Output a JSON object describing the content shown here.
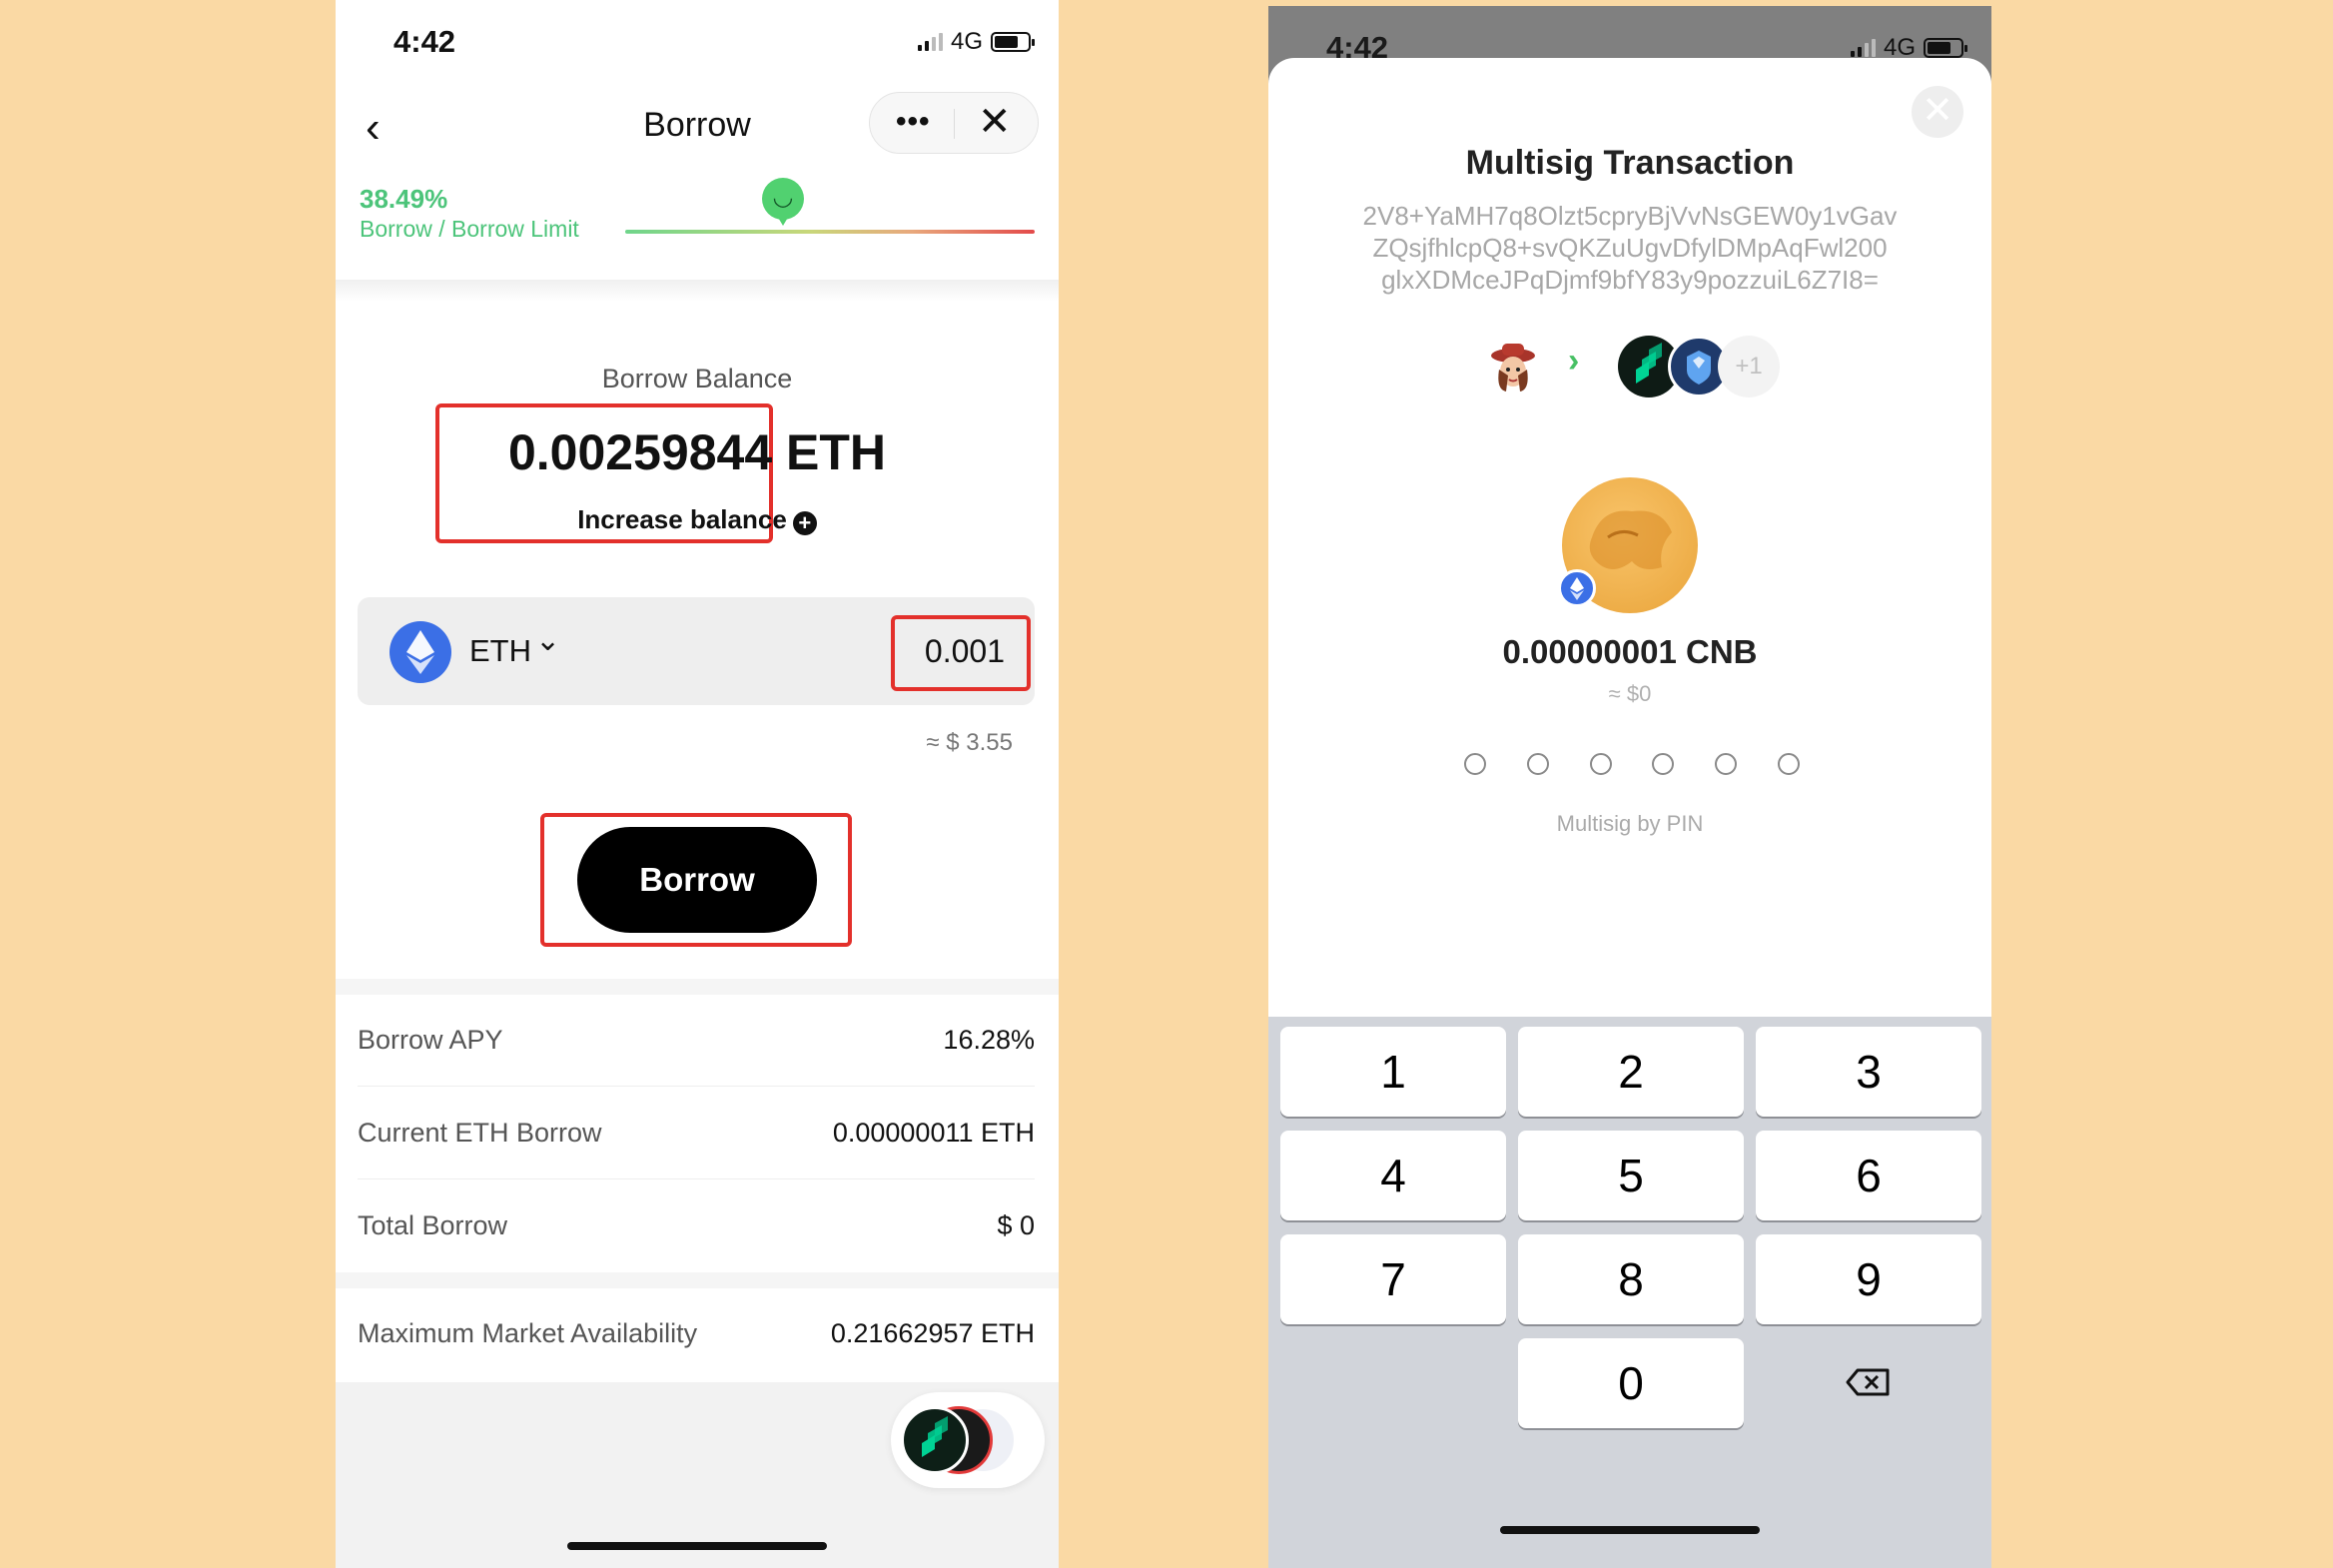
{
  "left": {
    "status": {
      "time": "4:42",
      "network": "4G"
    },
    "nav": {
      "title": "Borrow"
    },
    "borrow_limit": {
      "percent_text": "38.49%",
      "label": "Borrow / Borrow Limit",
      "level": 0.3849
    },
    "balance": {
      "label": "Borrow Balance",
      "value": "0.00259844 ETH",
      "increase_label": "Increase balance"
    },
    "asset": {
      "symbol": "ETH",
      "amount": "0.001",
      "usd_estimate": "≈ $ 3.55"
    },
    "borrow_button": "Borrow",
    "stats": [
      {
        "label": "Borrow APY",
        "value": "16.28%"
      },
      {
        "label": "Current ETH Borrow",
        "value": "0.00000011 ETH"
      },
      {
        "label": "Total Borrow",
        "value": "$ 0"
      }
    ],
    "market": {
      "label": "Maximum Market Availability",
      "value": "0.21662957 ETH"
    }
  },
  "right": {
    "status": {
      "time": "4:42",
      "network": "4G"
    },
    "title": "Multisig Transaction",
    "hash_lines": [
      "2V8+YaMH7q8Olzt5cpryBjVvNsGEW0y1vGav",
      "ZQsjfhlcpQ8+svQKZuUgvDfylDMpAqFwl200",
      "glxXDMceJPqDjmf9bfY83y9pozzuiL6Z7I8="
    ],
    "signers_more": "+1",
    "amount": "0.00000001 CNB",
    "usd_estimate": "≈ $0",
    "pin_caption": "Multisig by PIN",
    "keys": [
      "1",
      "2",
      "3",
      "4",
      "5",
      "6",
      "7",
      "8",
      "9",
      "0"
    ]
  }
}
